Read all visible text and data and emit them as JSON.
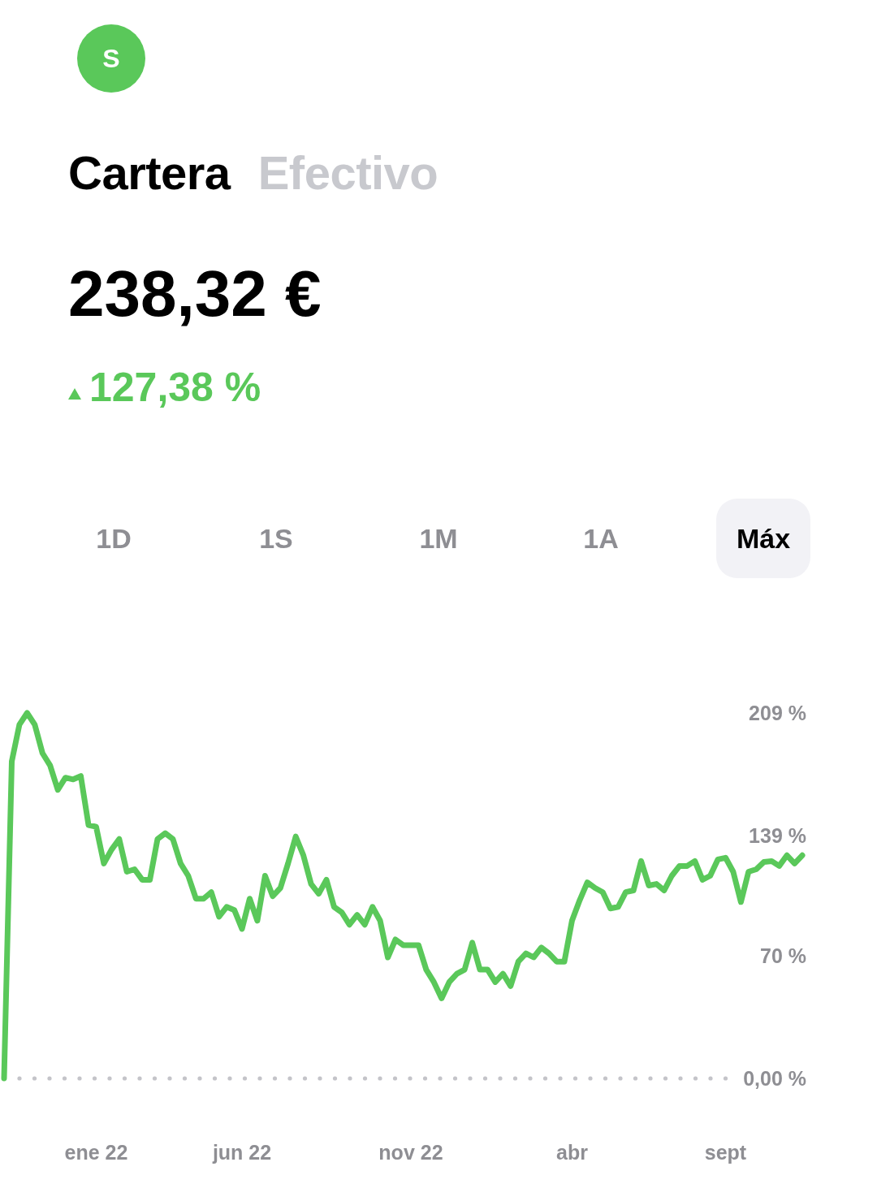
{
  "avatar": {
    "initial": "S"
  },
  "tabs": [
    {
      "label": "Cartera",
      "selected": true
    },
    {
      "label": "Efectivo",
      "selected": false
    }
  ],
  "balance": "238,32 €",
  "change": {
    "text": "127,38 %"
  },
  "periods": [
    {
      "label": "1D",
      "selected": false
    },
    {
      "label": "1S",
      "selected": false
    },
    {
      "label": "1M",
      "selected": false
    },
    {
      "label": "1A",
      "selected": false
    },
    {
      "label": "Máx",
      "selected": true
    }
  ],
  "chart_data": {
    "type": "line",
    "categories": [
      null,
      null,
      null,
      null,
      null,
      null,
      null,
      null,
      null,
      null,
      null,
      null,
      "ene 22",
      null,
      null,
      null,
      null,
      null,
      null,
      null,
      null,
      null,
      null,
      null,
      null,
      null,
      null,
      null,
      null,
      null,
      null,
      "jun 22",
      null,
      null,
      null,
      null,
      null,
      null,
      null,
      null,
      null,
      null,
      null,
      null,
      null,
      null,
      null,
      null,
      null,
      null,
      null,
      null,
      null,
      "nov 22",
      null,
      null,
      null,
      null,
      null,
      null,
      null,
      null,
      null,
      null,
      null,
      null,
      null,
      null,
      null,
      null,
      null,
      null,
      null,
      null,
      "abr",
      null,
      null,
      null,
      null,
      null,
      null,
      null,
      null,
      null,
      null,
      null,
      null,
      null,
      null,
      null,
      null,
      null,
      null,
      null,
      "sept",
      null,
      null,
      null,
      null,
      null,
      null,
      null,
      null,
      null,
      null
    ],
    "series": [
      {
        "color": "#5ac85a",
        "values": [
          0,
          181.3,
          202.3,
          209,
          202.3,
          186.0,
          179.0,
          165.0,
          172.0,
          171.0,
          172.9,
          144.9,
          143.9,
          122.9,
          130.8,
          136.9,
          118.2,
          119.6,
          113.6,
          113.6,
          136.9,
          140.2,
          136.9,
          122.9,
          115.9,
          102.8,
          102.8,
          106.5,
          92.5,
          98.1,
          96.3,
          85.5,
          102.8,
          90.2,
          115.9,
          104.2,
          108.9,
          122.9,
          138.3,
          127.6,
          111.2,
          105.6,
          113.6,
          98.1,
          94.9,
          87.9,
          93.5,
          87.9,
          98.1,
          90.2,
          69.2,
          79.4,
          76.2,
          76.2,
          76.2,
          62.2,
          55.1,
          45.8,
          55.1,
          59.8,
          62.2,
          77.6,
          62.2,
          62.2,
          55.1,
          59.8,
          52.8,
          66.8,
          71.5,
          69.2,
          74.8,
          71.5,
          66.8,
          66.8,
          90.2,
          101.9,
          112.1,
          108.9,
          106.5,
          97.2,
          98.1,
          106.5,
          107.5,
          124.3,
          110.3,
          111.2,
          107.5,
          115.9,
          121.5,
          121.5,
          124.3,
          113.6,
          115.9,
          125.2,
          126.2,
          118.2,
          100.9,
          118.2,
          119.6,
          123.8,
          124.3,
          121.5,
          127.6,
          122.9,
          127.6
        ]
      }
    ],
    "ylim": [
      0,
      209
    ],
    "yticks": [
      {
        "value": 0,
        "label": "0,00 %"
      },
      {
        "value": 70,
        "label": "70 %"
      },
      {
        "value": 139,
        "label": "139 %"
      },
      {
        "value": 209,
        "label": "209 %"
      }
    ]
  }
}
